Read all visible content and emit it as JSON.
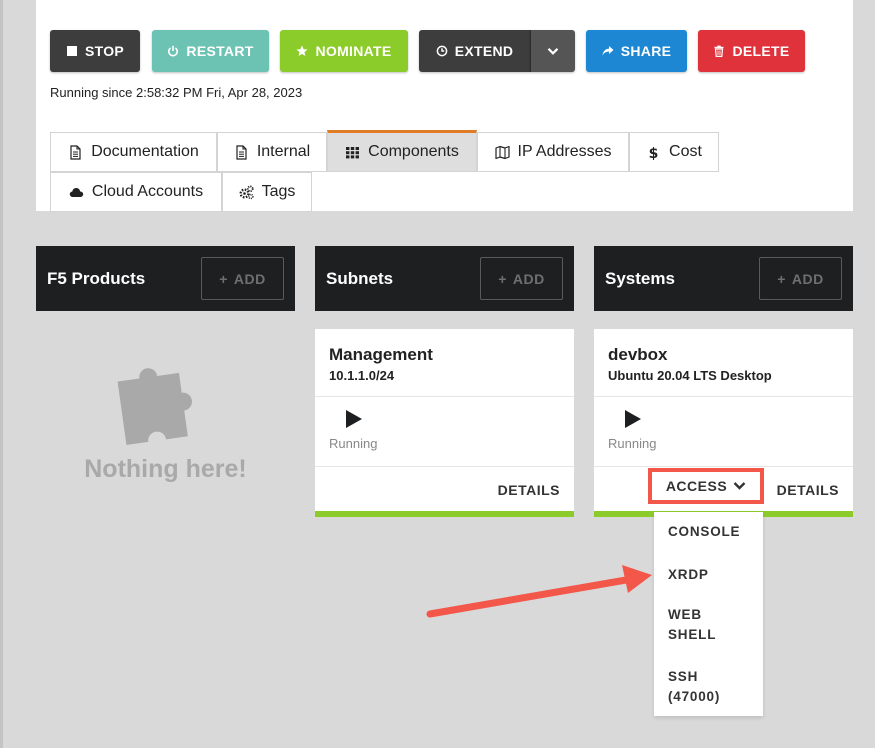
{
  "toolbar": {
    "stop": "STOP",
    "restart": "RESTART",
    "nominate": "NOMINATE",
    "extend": "EXTEND",
    "share": "SHARE",
    "delete": "DELETE"
  },
  "status_line": "Running since 2:58:32 PM Fri, Apr 28, 2023",
  "tabs": [
    {
      "label": "Documentation",
      "icon": "document-icon"
    },
    {
      "label": "Internal",
      "icon": "document-icon"
    },
    {
      "label": "Components",
      "icon": "grid-icon",
      "active": true
    },
    {
      "label": "IP Addresses",
      "icon": "map-icon"
    },
    {
      "label": "Cost",
      "icon": "dollar-icon"
    },
    {
      "label": "Cloud Accounts",
      "icon": "cloud-icon"
    },
    {
      "label": "Tags",
      "icon": "cogs-icon"
    }
  ],
  "add_label": "ADD",
  "columns": [
    {
      "title": "F5 Products"
    },
    {
      "title": "Subnets"
    },
    {
      "title": "Systems"
    }
  ],
  "empty_state": "Nothing here!",
  "subnet_card": {
    "name": "Management",
    "subtitle": "10.1.1.0/24",
    "status": "Running",
    "details": "DETAILS"
  },
  "system_card": {
    "name": "devbox",
    "subtitle": "Ubuntu 20.04 LTS Desktop",
    "status": "Running",
    "access": "ACCESS",
    "details": "DETAILS"
  },
  "access_menu": [
    "CONSOLE",
    "XRDP",
    "WEB SHELL",
    "SSH (47000)"
  ],
  "colors": {
    "stop": "#3d3d3d",
    "restart": "#6dc3b3",
    "nominate": "#8ccc2a",
    "share": "#1e87d4",
    "delete": "#e0323b",
    "active_tab_accent": "#e07b26",
    "annotation": "#f2574a"
  }
}
